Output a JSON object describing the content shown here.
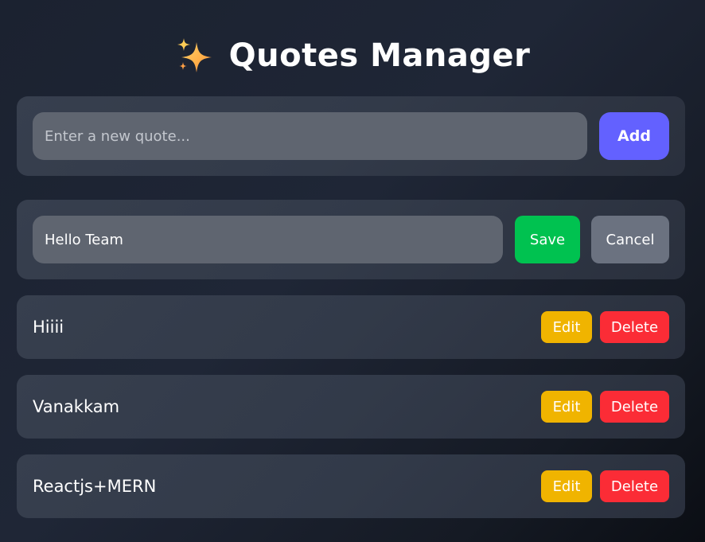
{
  "app": {
    "title": "Quotes Manager",
    "title_icon": "sparkles-icon"
  },
  "add_form": {
    "placeholder": "Enter a new quote...",
    "value": "",
    "add_label": "Add"
  },
  "edit_form": {
    "value": "Hello Team",
    "save_label": "Save",
    "cancel_label": "Cancel"
  },
  "quotes": [
    {
      "text": "Hiiii",
      "edit_label": "Edit",
      "delete_label": "Delete"
    },
    {
      "text": "Vanakkam",
      "edit_label": "Edit",
      "delete_label": "Delete"
    },
    {
      "text": "Reactjs+MERN",
      "edit_label": "Edit",
      "delete_label": "Delete"
    }
  ],
  "colors": {
    "add_button": "#6361ff",
    "save_button": "#00c250",
    "cancel_button": "#6b7280",
    "edit_button": "#f0b400",
    "delete_button": "#fb2c36",
    "card_background": "#343b4a",
    "input_background": "#5f6570"
  }
}
